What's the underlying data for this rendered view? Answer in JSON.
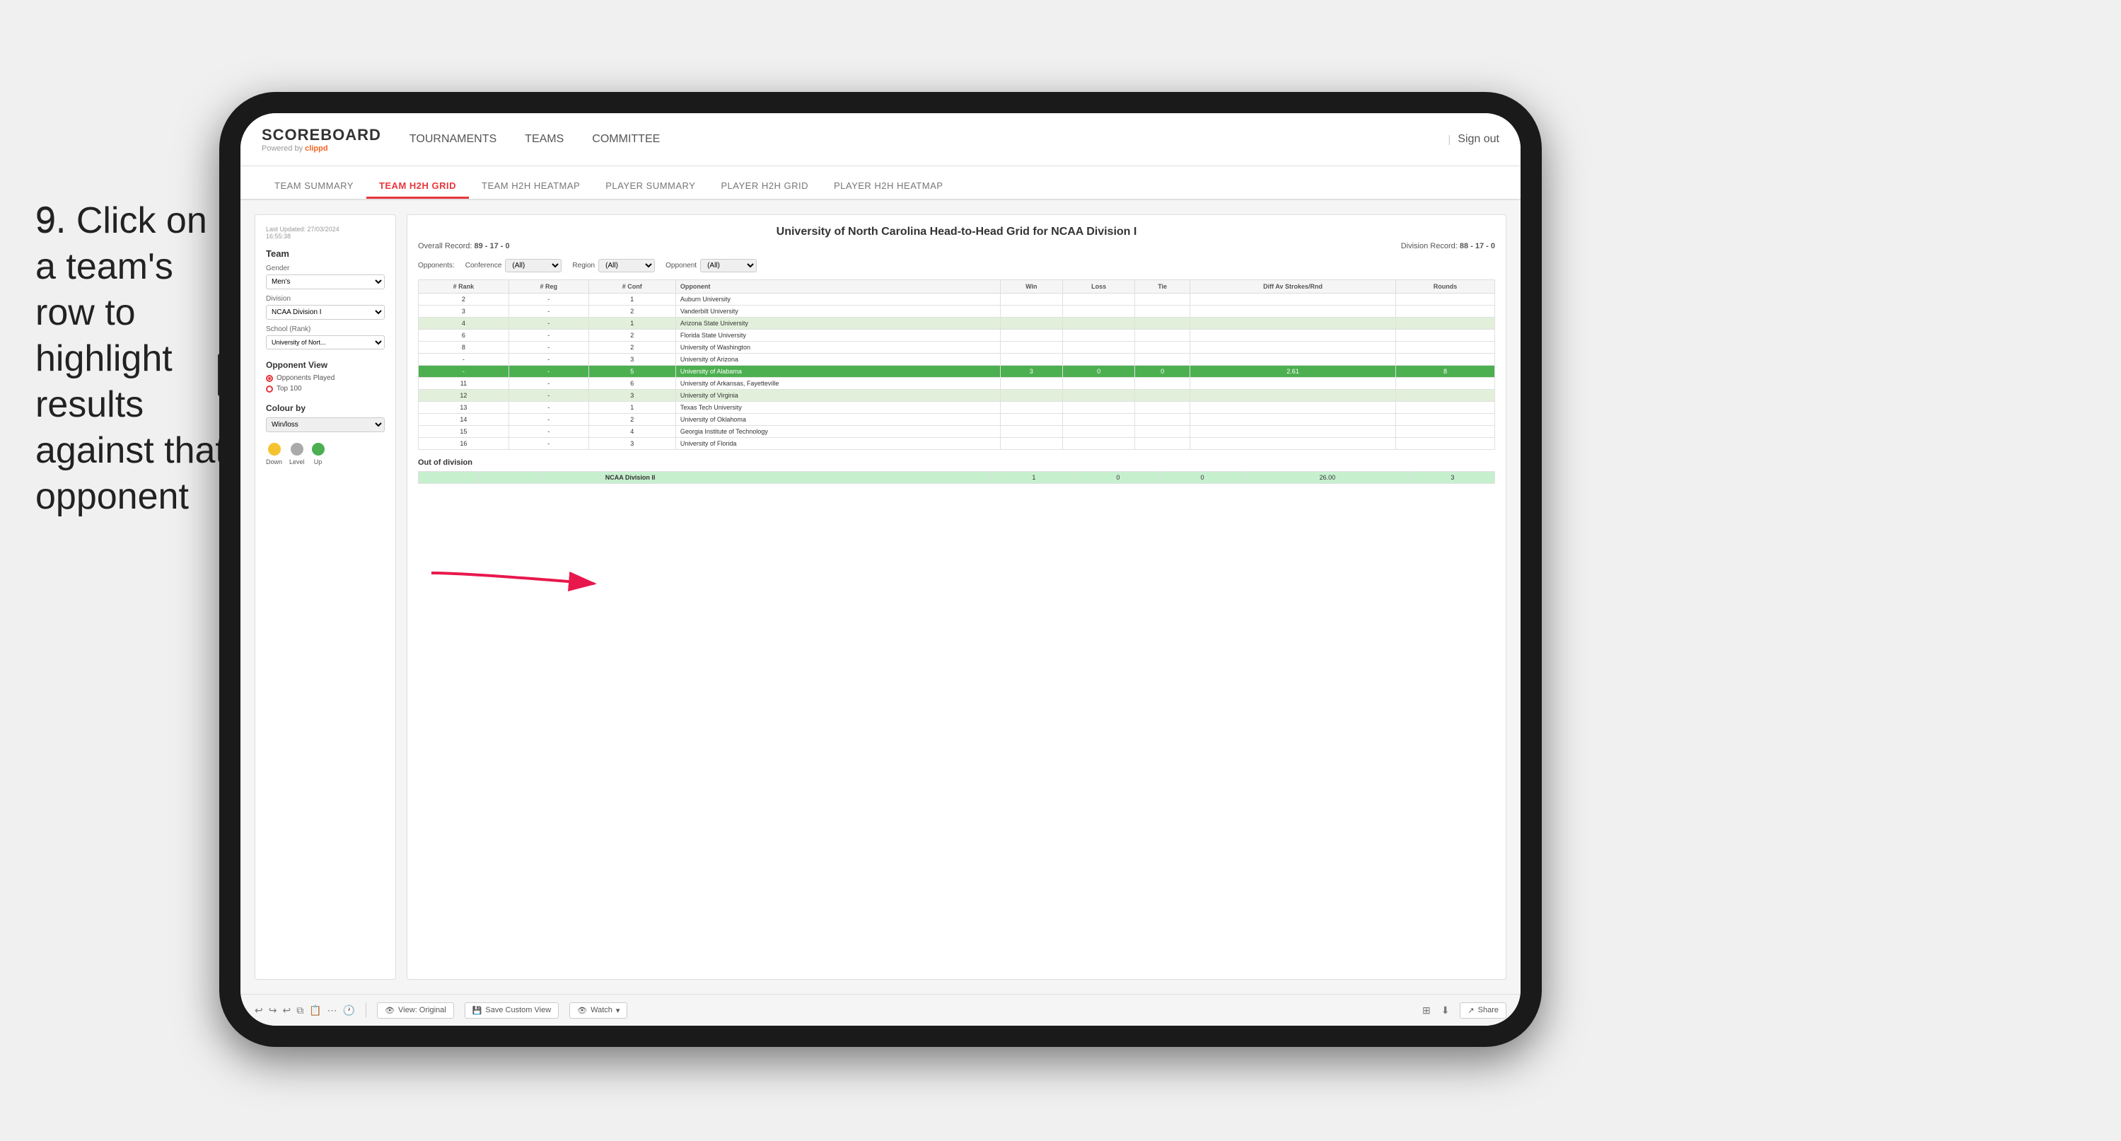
{
  "instruction": {
    "step": "9.",
    "text": "Click on a team's row to highlight results against that opponent"
  },
  "app": {
    "logo": "SCOREBOARD",
    "powered_by": "Powered by",
    "brand": "clippd",
    "sign_out_separator": "|",
    "sign_out": "Sign out"
  },
  "top_nav": {
    "links": [
      "TOURNAMENTS",
      "TEAMS",
      "COMMITTEE"
    ]
  },
  "sub_nav": {
    "items": [
      "TEAM SUMMARY",
      "TEAM H2H GRID",
      "TEAM H2H HEATMAP",
      "PLAYER SUMMARY",
      "PLAYER H2H GRID",
      "PLAYER H2H HEATMAP"
    ],
    "active": "TEAM H2H GRID"
  },
  "sidebar": {
    "last_updated_label": "Last Updated: 27/03/2024",
    "last_updated_time": "16:55:38",
    "team_label": "Team",
    "gender_label": "Gender",
    "gender_value": "Men's",
    "division_label": "Division",
    "division_value": "NCAA Division I",
    "school_label": "School (Rank)",
    "school_value": "University of Nort...",
    "opponent_view_label": "Opponent View",
    "radio_opponents": "Opponents Played",
    "radio_top100": "Top 100",
    "colour_by_label": "Colour by",
    "colour_value": "Win/loss",
    "legend_down": "Down",
    "legend_level": "Level",
    "legend_up": "Up",
    "legend_down_color": "#f4c430",
    "legend_level_color": "#aaaaaa",
    "legend_up_color": "#4CAF50"
  },
  "grid": {
    "title": "University of North Carolina Head-to-Head Grid for NCAA Division I",
    "overall_record_label": "Overall Record:",
    "overall_record_value": "89 - 17 - 0",
    "division_record_label": "Division Record:",
    "division_record_value": "88 - 17 - 0",
    "filter_opponents_label": "Opponents:",
    "filter_conf_label": "Conference",
    "filter_conf_value": "(All)",
    "filter_region_label": "Region",
    "filter_region_value": "(All)",
    "filter_opponent_label": "Opponent",
    "filter_opponent_value": "(All)",
    "columns": {
      "rank": "# Rank",
      "reg": "# Reg",
      "conf": "# Conf",
      "opponent": "Opponent",
      "win": "Win",
      "loss": "Loss",
      "tie": "Tie",
      "diff": "Diff Av Strokes/Rnd",
      "rounds": "Rounds"
    },
    "rows": [
      {
        "rank": "2",
        "reg": "-",
        "conf": "1",
        "opponent": "Auburn University",
        "win": "",
        "loss": "",
        "tie": "",
        "diff": "",
        "rounds": "",
        "style": "normal"
      },
      {
        "rank": "3",
        "reg": "-",
        "conf": "2",
        "opponent": "Vanderbilt University",
        "win": "",
        "loss": "",
        "tie": "",
        "diff": "",
        "rounds": "",
        "style": "normal"
      },
      {
        "rank": "4",
        "reg": "-",
        "conf": "1",
        "opponent": "Arizona State University",
        "win": "",
        "loss": "",
        "tie": "",
        "diff": "",
        "rounds": "",
        "style": "light-green"
      },
      {
        "rank": "6",
        "reg": "-",
        "conf": "2",
        "opponent": "Florida State University",
        "win": "",
        "loss": "",
        "tie": "",
        "diff": "",
        "rounds": "",
        "style": "normal"
      },
      {
        "rank": "8",
        "reg": "-",
        "conf": "2",
        "opponent": "University of Washington",
        "win": "",
        "loss": "",
        "tie": "",
        "diff": "",
        "rounds": "",
        "style": "normal"
      },
      {
        "rank": "-",
        "reg": "-",
        "conf": "3",
        "opponent": "University of Arizona",
        "win": "",
        "loss": "",
        "tie": "",
        "diff": "",
        "rounds": "",
        "style": "normal"
      },
      {
        "rank": "-",
        "reg": "-",
        "conf": "5",
        "opponent": "University of Alabama",
        "win": "3",
        "loss": "0",
        "tie": "0",
        "diff": "2.61",
        "rounds": "8",
        "style": "selected"
      },
      {
        "rank": "11",
        "reg": "-",
        "conf": "6",
        "opponent": "University of Arkansas, Fayetteville",
        "win": "",
        "loss": "",
        "tie": "",
        "diff": "",
        "rounds": "",
        "style": "normal"
      },
      {
        "rank": "12",
        "reg": "-",
        "conf": "3",
        "opponent": "University of Virginia",
        "win": "",
        "loss": "",
        "tie": "",
        "diff": "",
        "rounds": "",
        "style": "light-green"
      },
      {
        "rank": "13",
        "reg": "-",
        "conf": "1",
        "opponent": "Texas Tech University",
        "win": "",
        "loss": "",
        "tie": "",
        "diff": "",
        "rounds": "",
        "style": "normal"
      },
      {
        "rank": "14",
        "reg": "-",
        "conf": "2",
        "opponent": "University of Oklahoma",
        "win": "",
        "loss": "",
        "tie": "",
        "diff": "",
        "rounds": "",
        "style": "normal"
      },
      {
        "rank": "15",
        "reg": "-",
        "conf": "4",
        "opponent": "Georgia Institute of Technology",
        "win": "",
        "loss": "",
        "tie": "",
        "diff": "",
        "rounds": "",
        "style": "normal"
      },
      {
        "rank": "16",
        "reg": "-",
        "conf": "3",
        "opponent": "University of Florida",
        "win": "",
        "loss": "",
        "tie": "",
        "diff": "",
        "rounds": "",
        "style": "normal"
      }
    ],
    "out_of_division_label": "Out of division",
    "out_div_row": {
      "division": "NCAA Division II",
      "win": "1",
      "loss": "0",
      "tie": "0",
      "diff": "26.00",
      "rounds": "3"
    }
  },
  "toolbar": {
    "view_label": "View: Original",
    "save_custom_label": "Save Custom View",
    "watch_label": "Watch",
    "share_label": "Share"
  }
}
